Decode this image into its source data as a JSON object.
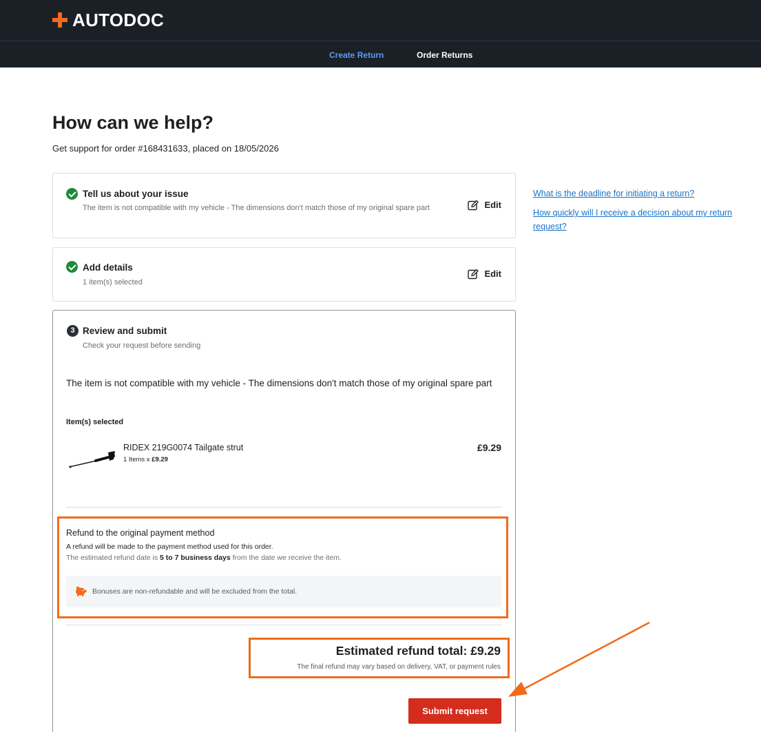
{
  "header": {
    "logo_text": "AUTODOC",
    "nav": {
      "create_return": "Create Return",
      "order_returns": "Order Returns"
    }
  },
  "page": {
    "title": "How can we help?",
    "subtitle": "Get support for order #168431633, placed on 18/05/2026"
  },
  "steps": [
    {
      "title": "Tell us about your issue",
      "desc": "The item is not compatible with my vehicle - The dimensions don't match those of my original spare part",
      "edit_label": "Edit",
      "status": "done"
    },
    {
      "title": "Add details",
      "desc": "1 item(s) selected",
      "edit_label": "Edit",
      "status": "done"
    },
    {
      "number": "3",
      "title": "Review and submit",
      "desc": "Check your request before sending",
      "status": "current"
    }
  ],
  "review": {
    "reason": "The item is not compatible with my vehicle - The dimensions don't match those of my original spare part",
    "items_label": "Item(s) selected",
    "item": {
      "name": "RIDEX 219G0074 Tailgate strut",
      "qty_prefix": "1 Items x ",
      "qty_price": "£9.29",
      "price": "£9.29",
      "thumb_icon": "tailgate-strut-image"
    }
  },
  "refund": {
    "title": "Refund to the original payment method",
    "line1": "A refund will be made to the payment method used for this order.",
    "line2_prefix": "The estimated refund date is ",
    "line2_bold": "5 to 7 business days",
    "line2_suffix": " from the date we receive the item.",
    "bonus_note": "Bonuses are non-refundable and will be excluded from the total.",
    "bonus_icon": "piggy-bank-icon"
  },
  "total": {
    "label": "Estimated refund total: £9.29",
    "note": "The final refund may vary based on delivery, VAT, or payment rules"
  },
  "submit_label": "Submit request",
  "faq": [
    "What is the deadline for initiating a return?",
    "How quickly will I receive a decision about my return request?"
  ],
  "colors": {
    "header_bg": "#1b2027",
    "brand_orange": "#f26b1d",
    "nav_active": "#5e9bf0",
    "success_green": "#1f8a3a",
    "submit_red": "#d42c1d",
    "link_blue": "#1a73c8",
    "annotation_orange": "#f06a1a"
  }
}
